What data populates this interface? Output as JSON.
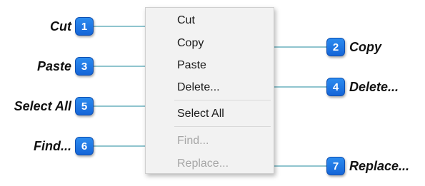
{
  "menu": {
    "items": [
      {
        "label": "Cut",
        "enabled": true
      },
      {
        "label": "Copy",
        "enabled": true
      },
      {
        "label": "Paste",
        "enabled": true
      },
      {
        "label": "Delete...",
        "enabled": true
      },
      {
        "label": "Select All",
        "enabled": true
      },
      {
        "label": "Find...",
        "enabled": false
      },
      {
        "label": "Replace...",
        "enabled": false
      }
    ]
  },
  "callouts": [
    {
      "number": "1",
      "label": "Cut"
    },
    {
      "number": "2",
      "label": "Copy"
    },
    {
      "number": "3",
      "label": "Paste"
    },
    {
      "number": "4",
      "label": "Delete..."
    },
    {
      "number": "5",
      "label": "Select All"
    },
    {
      "number": "6",
      "label": "Find..."
    },
    {
      "number": "7",
      "label": "Replace..."
    }
  ],
  "colors": {
    "badge": "#1a73e6",
    "callout_line": "#1f8a9e",
    "menu_background": "#f2f2f2",
    "disabled_text": "#a6a6a6"
  }
}
